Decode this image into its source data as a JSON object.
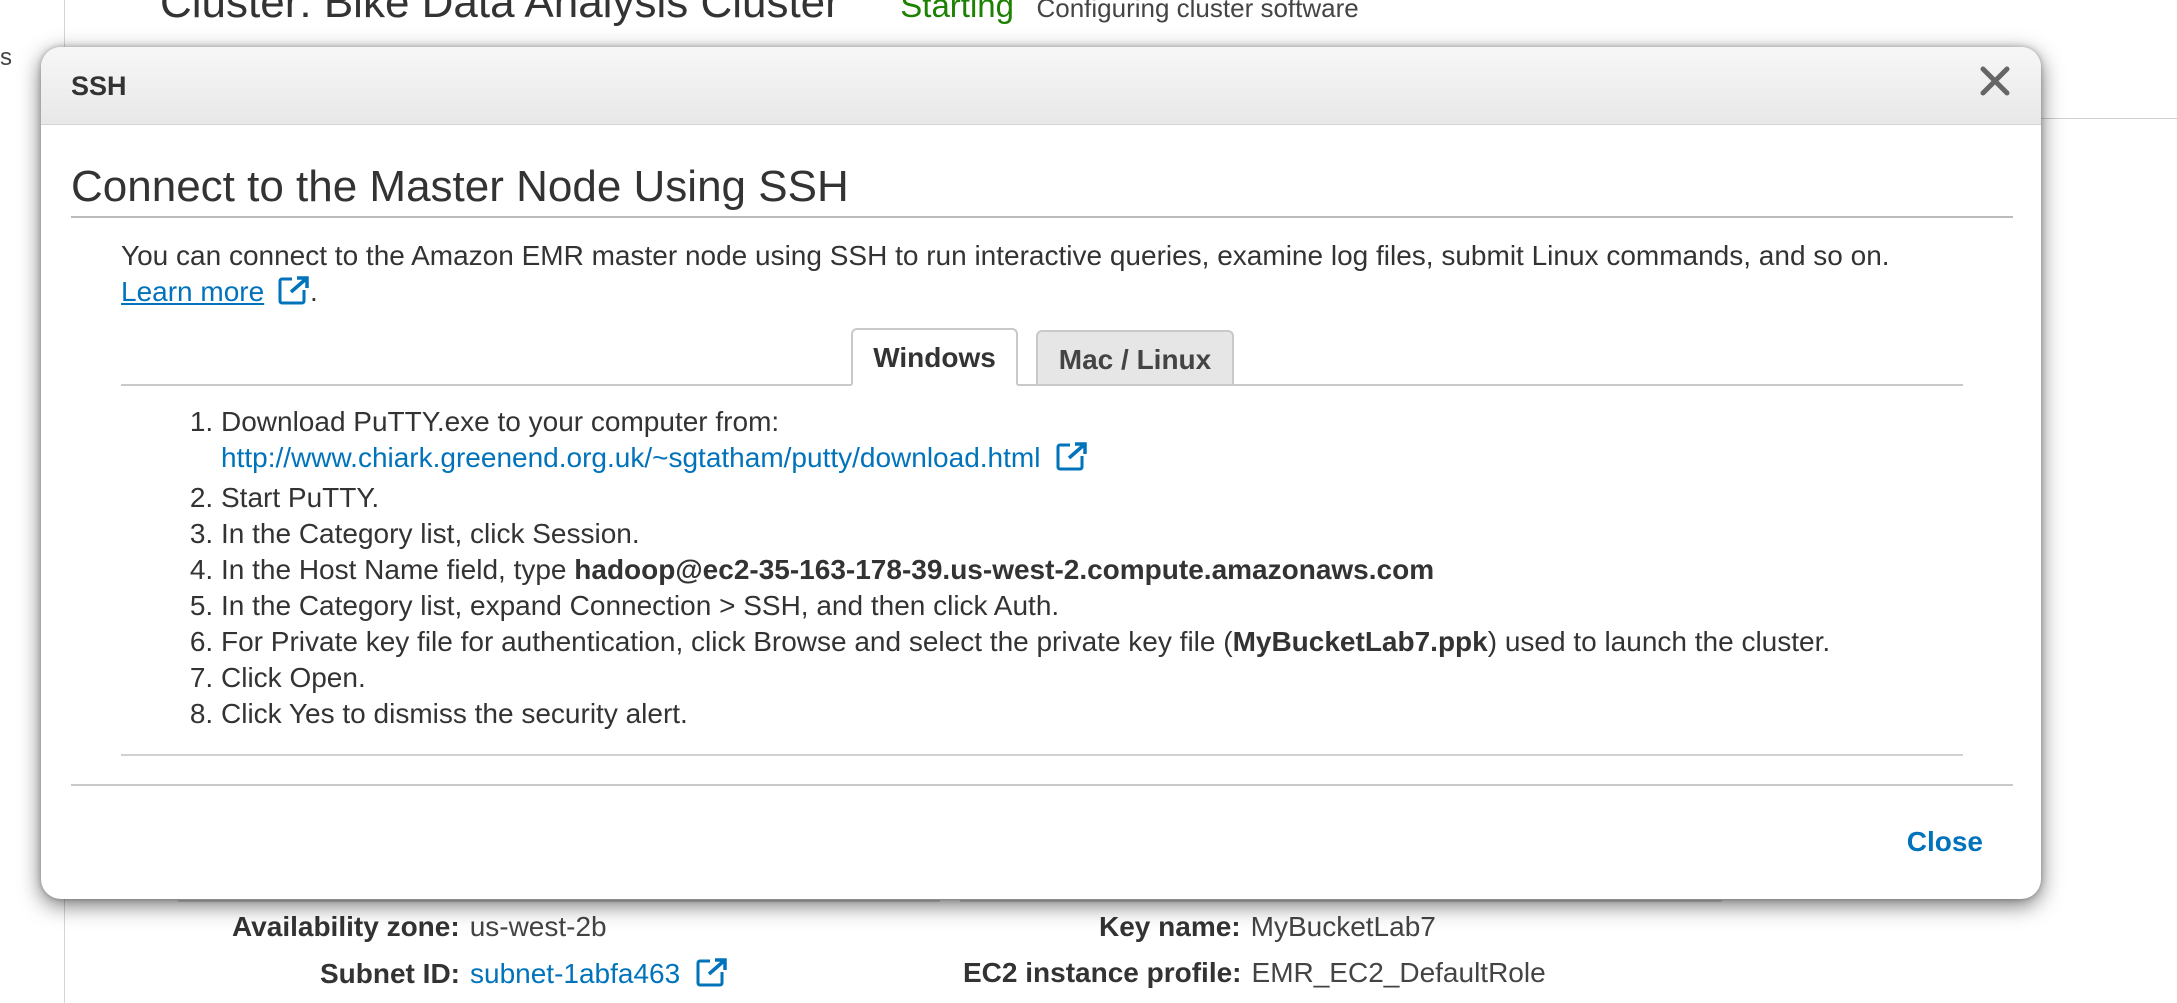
{
  "background": {
    "left_nav_fragment": "s",
    "cluster_title": "Cluster: Bike Data Analysis Cluster",
    "status": "Starting",
    "status_detail": "Configuring cluster software",
    "details": {
      "availability_zone_label": "Availability zone:",
      "availability_zone_value": "us-west-2b",
      "subnet_id_label": "Subnet ID:",
      "subnet_id_value": "subnet-1abfa463",
      "key_name_label": "Key name:",
      "key_name_value": "MyBucketLab7",
      "ec2_profile_label": "EC2 instance profile:",
      "ec2_profile_value": "EMR_EC2_DefaultRole"
    }
  },
  "modal": {
    "title": "SSH",
    "close_icon": "close-x-icon",
    "heading": "Connect to the Master Node Using SSH",
    "intro": "You can connect to the Amazon EMR master node using SSH to run interactive queries, examine log files, submit Linux commands, and so on.",
    "learn_more": "Learn more",
    "intro_end": ".",
    "tabs": [
      "Windows",
      "Mac / Linux"
    ],
    "active_tab": "Windows",
    "steps": {
      "s1": "Download PuTTY.exe to your computer from:",
      "s1_link": "http://www.chiark.greenend.org.uk/~sgtatham/putty/download.html",
      "s2": "Start PuTTY.",
      "s3": "In the Category list, click Session.",
      "s4_prefix": "In the Host Name field, type ",
      "s4_host": "hadoop@ec2-35-163-178-39.us-west-2.compute.amazonaws.com",
      "s5": "In the Category list, expand Connection > SSH, and then click Auth.",
      "s6_prefix": "For Private key file for authentication, click Browse and select the private key file (",
      "s6_key": "MyBucketLab7.ppk",
      "s6_suffix": ") used to launch the cluster.",
      "s7": "Click Open.",
      "s8": "Click Yes to dismiss the security alert."
    },
    "close_button": "Close"
  },
  "colors": {
    "link": "#0073bb",
    "status_green": "#1d8102"
  }
}
